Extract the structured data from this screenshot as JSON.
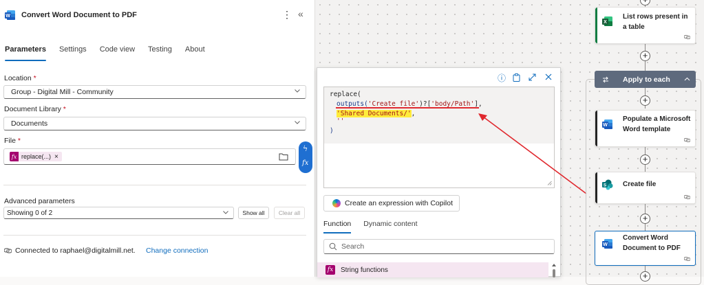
{
  "panel": {
    "title": "Convert Word Document to PDF",
    "more_icon": "more-vertical-icon",
    "collapse_icon": "double-chevron-left-icon",
    "tabs": [
      {
        "label": "Parameters",
        "active": true
      },
      {
        "label": "Settings"
      },
      {
        "label": "Code view"
      },
      {
        "label": "Testing"
      },
      {
        "label": "About"
      }
    ],
    "location": {
      "label": "Location",
      "required_mark": "*",
      "value": "Group - Digital Mill - Community"
    },
    "library": {
      "label": "Document Library",
      "required_mark": "*",
      "value": "Documents"
    },
    "file": {
      "label": "File",
      "required_mark": "*",
      "token_fx": "fx",
      "token_label": "replace(...)",
      "token_remove": "×"
    },
    "side_pill": {
      "dynamic_icon": "ϟ",
      "fx": "fx"
    },
    "advanced": {
      "label": "Advanced parameters",
      "value": "Showing 0 of 2",
      "show_all": "Show all",
      "clear_all": "Clear all"
    },
    "connection": {
      "text": "Connected to raphael@digitalmill.net.",
      "change": "Change connection"
    }
  },
  "expression_popup": {
    "icons": [
      "info-icon",
      "copy-clipboard-icon",
      "expand-icon",
      "close-icon"
    ],
    "code": {
      "line1": "replace(",
      "line2_fn": "outputs(",
      "line2_str1": "'Create_file'",
      "line2_mid": ")?[",
      "line2_str2": "'body/Path'",
      "line2_end": "],",
      "line3_str": "'Shared Documents/'",
      "line3_end": ",",
      "line4": "''",
      "line5": ")"
    },
    "copilot_button": "Create an expression with Copilot",
    "tabs": [
      {
        "label": "Function",
        "active": true
      },
      {
        "label": "Dynamic content"
      }
    ],
    "search_placeholder": "Search",
    "function_category": {
      "fx": "fx",
      "label": "String functions"
    }
  },
  "flow": {
    "cards": [
      {
        "title": "List rows present in a table",
        "accent": "#107c41",
        "icon": "excel-icon"
      },
      {
        "title": "Populate a Microsoft Word template",
        "accent": "#242424",
        "icon": "word-icon"
      },
      {
        "title": "Create file",
        "accent": "#242424",
        "icon": "sharepoint-icon"
      },
      {
        "title": "Convert Word Document to PDF",
        "accent": "#0f6cbd",
        "icon": "word-icon",
        "selected": true
      }
    ],
    "apply_to_each": {
      "label": "Apply to each",
      "color": "#5e6a7d"
    },
    "plus": "+"
  },
  "colors": {
    "accent": "#0f6cbd",
    "fx_purple": "#a4006e",
    "annotation_red": "#e0282e",
    "highlight": "#ffeb3b"
  }
}
